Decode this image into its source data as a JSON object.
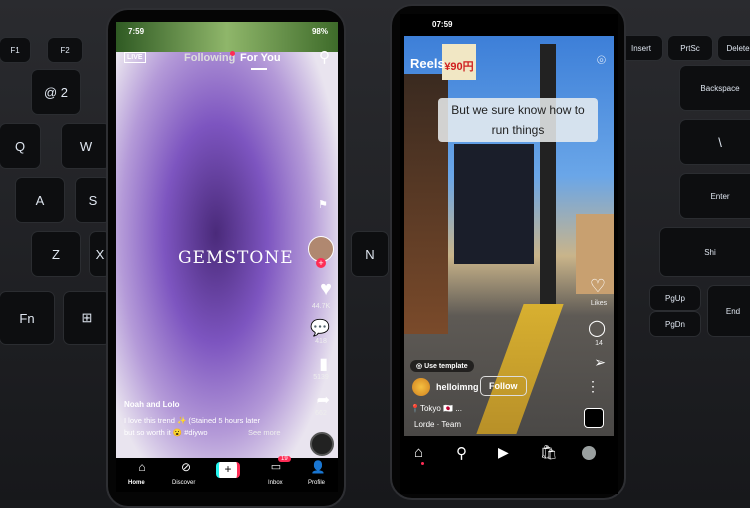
{
  "keyboard": {
    "left_keys": [
      "F1",
      "F2",
      "@\n2",
      "Q",
      "W",
      "A",
      "S",
      "Z",
      "X",
      "Fn",
      "⊞"
    ],
    "right_keys": [
      "Insert",
      "PrtSc",
      "Delete",
      "Backspace",
      "\\",
      "Enter",
      "Shi",
      "PgUp",
      "PgDn",
      "End",
      "N"
    ]
  },
  "tiktok": {
    "status": {
      "time": "7:59",
      "battery": "98%"
    },
    "tabs": {
      "live": "LIVE",
      "following": "Following",
      "for_you": "For You"
    },
    "overlay_text": "GEMSTONE",
    "actions": {
      "likes": "44.7K",
      "comments": "418",
      "saves": "5139",
      "shares": "662"
    },
    "caption": {
      "user": "Noah and Lolo",
      "text": "I love this trend ✨ (Stained 5 hours later",
      "text2": "but so worth it 😮 #diywo",
      "see_more": "See more"
    },
    "nav": {
      "home": "Home",
      "discover": "Discover",
      "inbox": "Inbox",
      "inbox_badge": "19",
      "profile": "Profile"
    },
    "accent": "#fe2c55"
  },
  "instagram": {
    "status": {
      "time": "07:59"
    },
    "title": "Reels",
    "sign_text": "¥90円",
    "subtitle": "But we sure know how to run things",
    "actions": {
      "likes": "Likes",
      "comments": "14"
    },
    "use_template": "Use template",
    "username": "helloimng",
    "follow": "Follow",
    "location": "📍Tokyo 🇯🇵 ...",
    "audio": "Lorde · Team"
  }
}
